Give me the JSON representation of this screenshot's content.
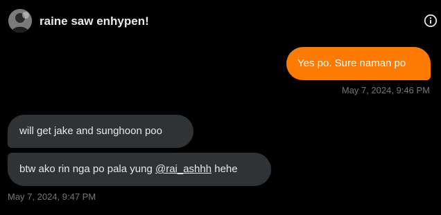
{
  "header": {
    "title": "raine saw enhypen!",
    "avatar_icon": "profile-avatar",
    "info_icon": "info-icon"
  },
  "messages": [
    {
      "direction": "sent",
      "text": "Yes po. Sure naman po"
    },
    {
      "direction": "received",
      "text": "will get jake and sunghoon poo"
    },
    {
      "direction": "received",
      "text_before": "btw ako rin nga po pala yung ",
      "mention": "@rai_ashhh",
      "text_after": " hehe"
    }
  ],
  "timestamps": {
    "sent": "May 7, 2024, 9:46 PM",
    "received": "May 7, 2024, 9:47 PM"
  },
  "colors": {
    "background": "#000000",
    "sent_bubble": "#ff7a00",
    "received_bubble": "#2f3336",
    "timestamp": "#71767b",
    "text": "#e7e9ea"
  }
}
